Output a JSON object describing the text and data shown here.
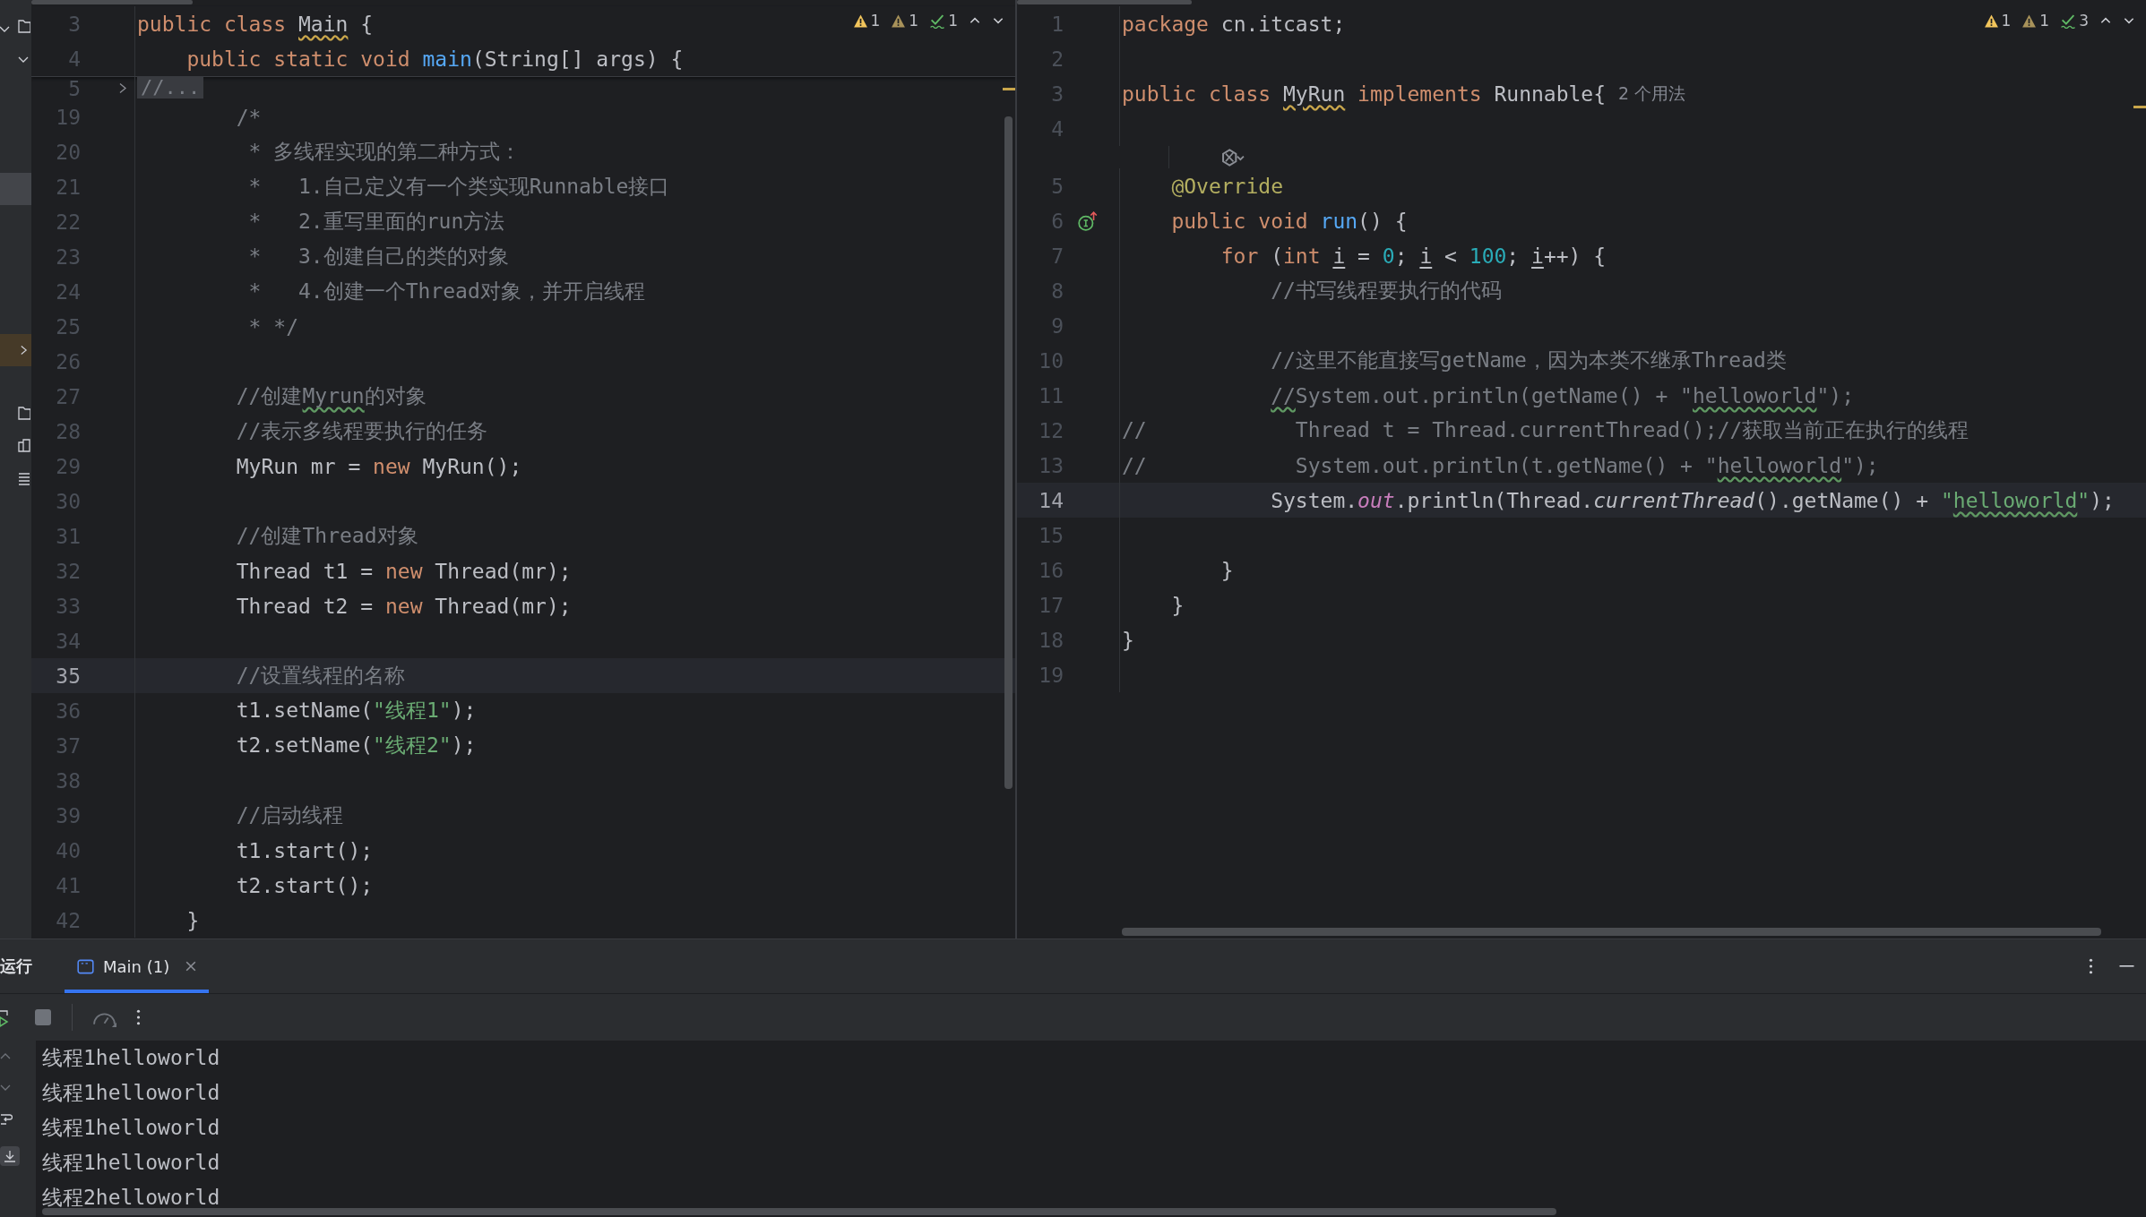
{
  "left_editor": {
    "inspections": [
      {
        "kind": "warning",
        "count": "1"
      },
      {
        "kind": "weak_warning",
        "count": "1"
      },
      {
        "kind": "typo",
        "count": "1"
      }
    ],
    "sticky_lines": [
      {
        "number": "3",
        "tokens": [
          {
            "kind": "keyword",
            "text": "public class "
          },
          {
            "kind": "typo_class",
            "text": "Main"
          },
          {
            "kind": "plain",
            "text": " {"
          }
        ]
      },
      {
        "number": "4",
        "tokens": [
          {
            "kind": "keyword",
            "text": "    public static void "
          },
          {
            "kind": "method",
            "text": "main"
          },
          {
            "kind": "plain",
            "text": "(String[] args) {"
          }
        ]
      }
    ],
    "lines": [
      {
        "number": "5",
        "kind": "folded",
        "current": false,
        "text": "//..."
      },
      {
        "number": "19",
        "kind": "code",
        "current": false,
        "tokens": [
          {
            "kind": "comment",
            "text": "        /*"
          }
        ]
      },
      {
        "number": "20",
        "kind": "code",
        "current": false,
        "tokens": [
          {
            "kind": "comment",
            "text": "         * 多线程实现的第二种方式："
          }
        ]
      },
      {
        "number": "21",
        "kind": "code",
        "current": false,
        "tokens": [
          {
            "kind": "comment",
            "text": "         *   1.自己定义有一个类实现Runnable接口"
          }
        ]
      },
      {
        "number": "22",
        "kind": "code",
        "current": false,
        "tokens": [
          {
            "kind": "comment",
            "text": "         *   2.重写里面的run方法"
          }
        ]
      },
      {
        "number": "23",
        "kind": "code",
        "current": false,
        "tokens": [
          {
            "kind": "comment",
            "text": "         *   3.创建自己的类的对象"
          }
        ]
      },
      {
        "number": "24",
        "kind": "code",
        "current": false,
        "tokens": [
          {
            "kind": "comment",
            "text": "         *   4.创建一个Thread对象，并开启线程"
          }
        ]
      },
      {
        "number": "25",
        "kind": "code",
        "current": false,
        "tokens": [
          {
            "kind": "comment",
            "text": "         * */"
          }
        ]
      },
      {
        "number": "26",
        "kind": "code",
        "current": false
      },
      {
        "number": "27",
        "kind": "code",
        "current": false,
        "tokens": [
          {
            "kind": "comment",
            "text": "        //创建"
          },
          {
            "kind": "typo_comment",
            "text": "Myrun"
          },
          {
            "kind": "comment",
            "text": "的对象"
          }
        ]
      },
      {
        "number": "28",
        "kind": "code",
        "current": false,
        "tokens": [
          {
            "kind": "comment",
            "text": "        //表示多线程要执行的任务"
          }
        ]
      },
      {
        "number": "29",
        "kind": "code",
        "current": false,
        "tokens": [
          {
            "kind": "plain",
            "text": "        MyRun mr = "
          },
          {
            "kind": "keyword",
            "text": "new "
          },
          {
            "kind": "plain",
            "text": "MyRun();"
          }
        ]
      },
      {
        "number": "30",
        "kind": "code",
        "current": false
      },
      {
        "number": "31",
        "kind": "code",
        "current": false,
        "tokens": [
          {
            "kind": "comment",
            "text": "        //创建Thread对象"
          }
        ]
      },
      {
        "number": "32",
        "kind": "code",
        "current": false,
        "tokens": [
          {
            "kind": "plain",
            "text": "        Thread t1 = "
          },
          {
            "kind": "keyword",
            "text": "new "
          },
          {
            "kind": "plain",
            "text": "Thread(mr);"
          }
        ]
      },
      {
        "number": "33",
        "kind": "code",
        "current": false,
        "tokens": [
          {
            "kind": "plain",
            "text": "        Thread t2 = "
          },
          {
            "kind": "keyword",
            "text": "new "
          },
          {
            "kind": "plain",
            "text": "Thread(mr);"
          }
        ]
      },
      {
        "number": "34",
        "kind": "code",
        "current": false
      },
      {
        "number": "35",
        "kind": "code",
        "current": true,
        "tokens": [
          {
            "kind": "comment",
            "text": "        //设置线程的名称"
          }
        ]
      },
      {
        "number": "36",
        "kind": "code",
        "current": false,
        "tokens": [
          {
            "kind": "plain",
            "text": "        t1.setName("
          },
          {
            "kind": "string",
            "text": "\"线程1\""
          },
          {
            "kind": "plain",
            "text": ");"
          }
        ]
      },
      {
        "number": "37",
        "kind": "code",
        "current": false,
        "tokens": [
          {
            "kind": "plain",
            "text": "        t2.setName("
          },
          {
            "kind": "string",
            "text": "\"线程2\""
          },
          {
            "kind": "plain",
            "text": ");"
          }
        ]
      },
      {
        "number": "38",
        "kind": "code",
        "current": false
      },
      {
        "number": "39",
        "kind": "code",
        "current": false,
        "tokens": [
          {
            "kind": "comment",
            "text": "        //启动线程"
          }
        ]
      },
      {
        "number": "40",
        "kind": "code",
        "current": false,
        "tokens": [
          {
            "kind": "plain",
            "text": "        t1.start();"
          }
        ]
      },
      {
        "number": "41",
        "kind": "code",
        "current": false,
        "tokens": [
          {
            "kind": "plain",
            "text": "        t2.start();"
          }
        ]
      },
      {
        "number": "42",
        "kind": "code",
        "current": false,
        "tokens": [
          {
            "kind": "plain",
            "text": "    }"
          }
        ]
      }
    ]
  },
  "right_editor": {
    "inspections": [
      {
        "kind": "warning",
        "count": "1"
      },
      {
        "kind": "weak_warning",
        "count": "1"
      },
      {
        "kind": "typo",
        "count": "3"
      }
    ],
    "lines": [
      {
        "number": "1",
        "kind": "code",
        "current": false,
        "tokens": [
          {
            "kind": "keyword",
            "text": "package "
          },
          {
            "kind": "plain",
            "text": "cn.itcast;"
          }
        ]
      },
      {
        "number": "2",
        "kind": "code",
        "current": false
      },
      {
        "number": "3",
        "kind": "code",
        "current": false,
        "tokens": [
          {
            "kind": "keyword",
            "text": "public class "
          },
          {
            "kind": "typo_class",
            "text": "MyRun"
          },
          {
            "kind": "keyword",
            "text": " implements "
          },
          {
            "kind": "plain",
            "text": "Runnable{"
          }
        ],
        "usages_hint": "2 个用法"
      },
      {
        "number": "4",
        "kind": "code",
        "current": false
      },
      {
        "kind": "inlay",
        "current": false
      },
      {
        "number": "5",
        "kind": "code",
        "current": false,
        "tokens": [
          {
            "kind": "annotation",
            "text": "    @Override"
          }
        ]
      },
      {
        "number": "6",
        "kind": "marked",
        "current": false,
        "tokens": [
          {
            "kind": "keyword",
            "text": "    public void "
          },
          {
            "kind": "method",
            "text": "run"
          },
          {
            "kind": "plain",
            "text": "() {"
          }
        ]
      },
      {
        "number": "7",
        "kind": "code",
        "current": false,
        "tokens": [
          {
            "kind": "keyword",
            "text": "        for "
          },
          {
            "kind": "plain",
            "text": "("
          },
          {
            "kind": "keyword",
            "text": "int "
          },
          {
            "kind": "variable",
            "text": "i"
          },
          {
            "kind": "plain",
            "text": " = "
          },
          {
            "kind": "number",
            "text": "0"
          },
          {
            "kind": "plain",
            "text": "; "
          },
          {
            "kind": "variable",
            "text": "i"
          },
          {
            "kind": "plain",
            "text": " < "
          },
          {
            "kind": "number",
            "text": "100"
          },
          {
            "kind": "plain",
            "text": "; "
          },
          {
            "kind": "variable",
            "text": "i"
          },
          {
            "kind": "plain",
            "text": "++) {"
          }
        ]
      },
      {
        "number": "8",
        "kind": "code",
        "current": false,
        "tokens": [
          {
            "kind": "comment",
            "text": "            //书写线程要执行的代码"
          }
        ]
      },
      {
        "number": "9",
        "kind": "code",
        "current": false
      },
      {
        "number": "10",
        "kind": "code",
        "current": false,
        "tokens": [
          {
            "kind": "comment",
            "text": "            //这里不能直接写getName，因为本类不继承Thread类"
          }
        ]
      },
      {
        "number": "11",
        "kind": "code",
        "current": false,
        "tokens": [
          {
            "kind": "typo_comment",
            "text": "            //"
          },
          {
            "kind": "comment",
            "text": "System.out.println(getName() + \""
          },
          {
            "kind": "typo_comment",
            "text": "helloworld"
          },
          {
            "kind": "comment",
            "text": "\");"
          }
        ]
      },
      {
        "number": "12",
        "kind": "code",
        "current": false,
        "tokens": [
          {
            "kind": "comment",
            "text": "//            Thread t = Thread.currentThread();//获取当前正在执行的线程"
          }
        ]
      },
      {
        "number": "13",
        "kind": "code",
        "current": false,
        "tokens": [
          {
            "kind": "comment",
            "text": "//            System.out.println(t.getName() + \""
          },
          {
            "kind": "typo_comment",
            "text": "helloworld"
          },
          {
            "kind": "comment",
            "text": "\");"
          }
        ]
      },
      {
        "number": "14",
        "kind": "code",
        "current": true,
        "tokens": [
          {
            "kind": "plain",
            "text": "            System."
          },
          {
            "kind": "field",
            "text": "out"
          },
          {
            "kind": "plain",
            "text": ".println(Thread."
          },
          {
            "kind": "static_call",
            "text": "currentThread"
          },
          {
            "kind": "plain",
            "text": "().getName() + "
          },
          {
            "kind": "string",
            "text": "\""
          },
          {
            "kind": "typo_string",
            "text": "helloworld"
          },
          {
            "kind": "string",
            "text": "\""
          },
          {
            "kind": "plain",
            "text": ");"
          }
        ]
      },
      {
        "number": "15",
        "kind": "code",
        "current": false
      },
      {
        "number": "16",
        "kind": "code",
        "current": false,
        "tokens": [
          {
            "kind": "plain",
            "text": "        }"
          }
        ]
      },
      {
        "number": "17",
        "kind": "code",
        "current": false,
        "tokens": [
          {
            "kind": "plain",
            "text": "    }"
          }
        ]
      },
      {
        "number": "18",
        "kind": "code",
        "current": false,
        "tokens": [
          {
            "kind": "plain",
            "text": "}"
          }
        ]
      },
      {
        "number": "19",
        "kind": "code",
        "current": false
      }
    ]
  },
  "run_panel": {
    "title": "运行",
    "tabs": [
      {
        "label": "Main (1)",
        "selected": true
      }
    ],
    "output": [
      "线程1helloworld",
      "线程1helloworld",
      "线程1helloworld",
      "线程1helloworld",
      "线程2helloworld"
    ]
  }
}
